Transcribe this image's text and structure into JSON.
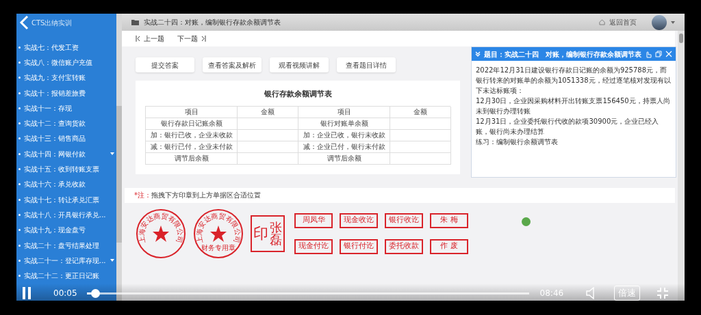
{
  "sidebar": {
    "title": "CTS出纳实训",
    "items": [
      {
        "label": "实战七：代发工资",
        "expandable": false
      },
      {
        "label": "实战八：微信账户充值",
        "expandable": false
      },
      {
        "label": "实战九：支付宝转账",
        "expandable": false
      },
      {
        "label": "实战十：报销差旅费",
        "expandable": false
      },
      {
        "label": "实战十一：存现",
        "expandable": false
      },
      {
        "label": "实战十二：查询货款",
        "expandable": false
      },
      {
        "label": "实战十三：销售商品",
        "expandable": false
      },
      {
        "label": "实战十四：网银付款",
        "expandable": true
      },
      {
        "label": "实战十五：收到转账支票",
        "expandable": false
      },
      {
        "label": "实战十六：承兑收款",
        "expandable": false
      },
      {
        "label": "实战十七：转让承兑汇票",
        "expandable": false
      },
      {
        "label": "实战十八：开具银行承兑...",
        "expandable": false
      },
      {
        "label": "实战十九：现金盘亏",
        "expandable": false
      },
      {
        "label": "实战二十：盘亏结果处理",
        "expandable": false
      },
      {
        "label": "实战二十一：登记库存现...",
        "expandable": true
      },
      {
        "label": "实战二十二：更正日记账",
        "expandable": false
      }
    ]
  },
  "header": {
    "title": "实战二十四：对账，编制银行存款余额调节表",
    "home_link": "返回首页"
  },
  "nav": {
    "prev": "上一题",
    "next": "下一题"
  },
  "actions": [
    "提交答案",
    "查看答案及解析",
    "观看视频讲解",
    "查看题目详情"
  ],
  "table": {
    "title": "银行存款余额调节表",
    "columns": [
      "项目",
      "金额",
      "项目",
      "金额"
    ],
    "rows": [
      {
        "left": "银行存款日记账余额",
        "right": "银行对账单余额"
      },
      {
        "left": "加：银行已收，企业未收款",
        "right": "加：企业已收，银行未收款"
      },
      {
        "left": "减：银行已付，企业未付款",
        "right": "减：企业已付，银行未付款"
      },
      {
        "left": "调节后余额",
        "right": "调节后余额"
      }
    ]
  },
  "note": {
    "mark": "*注：",
    "text": "拖拽下方印章到上方单据区合适位置"
  },
  "stamps": [
    {
      "kind": "round",
      "text": "上海安达商贸有限公司"
    },
    {
      "kind": "round",
      "text": "上海安达商贸有限公司",
      "subtext": "财务专用章"
    },
    {
      "kind": "name",
      "seal": "印",
      "name": "张磊"
    },
    {
      "kind": "rect",
      "text": "周凤华"
    },
    {
      "kind": "rect",
      "text": "现金收讫"
    },
    {
      "kind": "rect",
      "text": "银行收讫"
    },
    {
      "kind": "rect",
      "text": "朱 梅"
    },
    {
      "kind": "rect",
      "text": "现金付讫"
    },
    {
      "kind": "rect",
      "text": "银行付讫"
    },
    {
      "kind": "rect",
      "text": "委托收款"
    },
    {
      "kind": "rect",
      "text": "作 废"
    }
  ],
  "popup": {
    "title": "题目：实战二十四　对账，编制银行存款余额调节表",
    "paragraphs": [
      "2022年12月31日建设银行存款日记账的余额为925788元，而银行转来的对账单的余额为1051338元，经过逐笔核对发现有以下未达标账项：",
      "12月30日，企业因采购材料开出转账支票156450元，持票人尚未到银行办理转账",
      "12月31日，企业委托银行代收的款项30900元，企业已经入账，银行尚未办理结算",
      "练习：编制银行余额调节表"
    ]
  },
  "player": {
    "playing": true,
    "elapsed": "00:05",
    "duration": "08:46",
    "level": 0.0095,
    "speed": "倍速"
  }
}
